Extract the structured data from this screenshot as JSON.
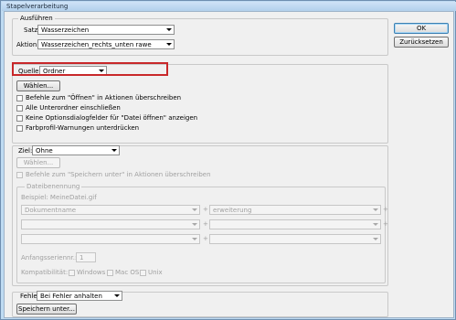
{
  "window": {
    "title": "Stapelverarbeitung"
  },
  "buttons": {
    "ok": "OK",
    "reset": "Zurücksetzen"
  },
  "ausfuehren": {
    "legend": "Ausführen",
    "satz_label": "Satz:",
    "satz_value": "Wasserzeichen",
    "aktion_label": "Aktion:",
    "aktion_value": "Wasserzeichen_rechts_unten rawe"
  },
  "quelle": {
    "label": "Quelle:",
    "value": "Ordner",
    "choose_button": "Wählen...",
    "options": [
      "Befehle zum \"Öffnen\" in Aktionen überschreiben",
      "Alle Unterordner einschließen",
      "Keine Optionsdialogfelder für \"Datei öffnen\" anzeigen",
      "Farbprofil-Warnungen unterdrücken"
    ]
  },
  "ziel": {
    "label": "Ziel:",
    "value": "Ohne",
    "choose_button": "Wählen...",
    "override_save": "Befehle zum \"Speichern unter\" in Aktionen überschreiben",
    "naming_legend": "Dateibenennung",
    "example_label": "Beispiel: MeineDatei.gif",
    "row1_left": "Dokumentname",
    "row1_right": "erweiterung",
    "sep": "+",
    "start_number_label": "Anfangsseriennr.:",
    "start_number_value": "1",
    "compat_label": "Kompatibilität:",
    "compat_windows": "Windows",
    "compat_mac": "Mac OS",
    "compat_unix": "Unix"
  },
  "fehler": {
    "label": "Fehler:",
    "value": "Bei Fehler anhalten",
    "save_as_button": "Speichern unter..."
  }
}
